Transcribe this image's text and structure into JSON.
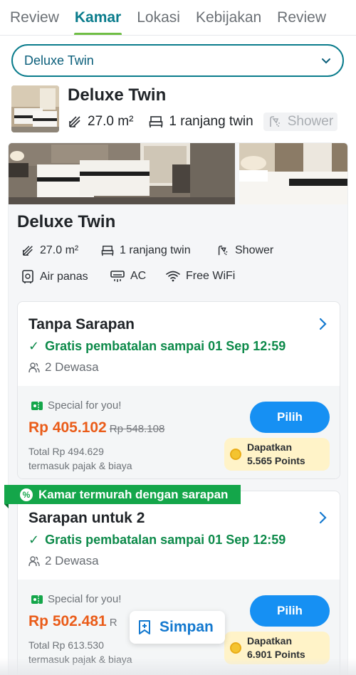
{
  "tabs": [
    "Review",
    "Kamar",
    "Lokasi",
    "Kebijakan",
    "Review"
  ],
  "room_select": {
    "value": "Deluxe Twin"
  },
  "room_header": {
    "title": "Deluxe Twin",
    "size": "27.0 m²",
    "bed": "1 ranjang twin",
    "shower": "Shower"
  },
  "card": {
    "title": "Deluxe Twin",
    "amenities": {
      "size": "27.0 m²",
      "bed": "1 ranjang twin",
      "shower": "Shower",
      "hot_water": "Air panas",
      "ac": "AC",
      "wifi": "Free WiFi"
    }
  },
  "rates": [
    {
      "name": "Tanpa Sarapan",
      "cancellation": "Gratis pembatalan sampai 01 Sep 12:59",
      "guests": "2 Dewasa",
      "special": "Special for you!",
      "price": "Rp 405.102",
      "old_price": "Rp 548.108",
      "total": "Total Rp 494.629",
      "tax_note": "termasuk pajak & biaya",
      "button": "Pilih",
      "points_label": "Dapatkan",
      "points": "5.565 Points"
    },
    {
      "ribbon": "Kamar termurah dengan sarapan",
      "name": "Sarapan untuk 2",
      "cancellation": "Gratis pembatalan sampai 01 Sep 12:59",
      "guests": "2 Dewasa",
      "special": "Special for you!",
      "price": "Rp 502.481",
      "old_price": "R",
      "total": "Total Rp 613.530",
      "tax_note": "termasuk pajak & biaya",
      "button": "Pilih",
      "points_label": "Dapatkan",
      "points": "6.901 Points"
    }
  ],
  "save_popup": {
    "label": "Simpan"
  },
  "colors": {
    "accent": "#0a7c8c",
    "tab_underline": "#6fbe44",
    "button": "#1690f3",
    "price": "#ea5c19",
    "green": "#0d8a4a",
    "ribbon": "#14a64a"
  }
}
